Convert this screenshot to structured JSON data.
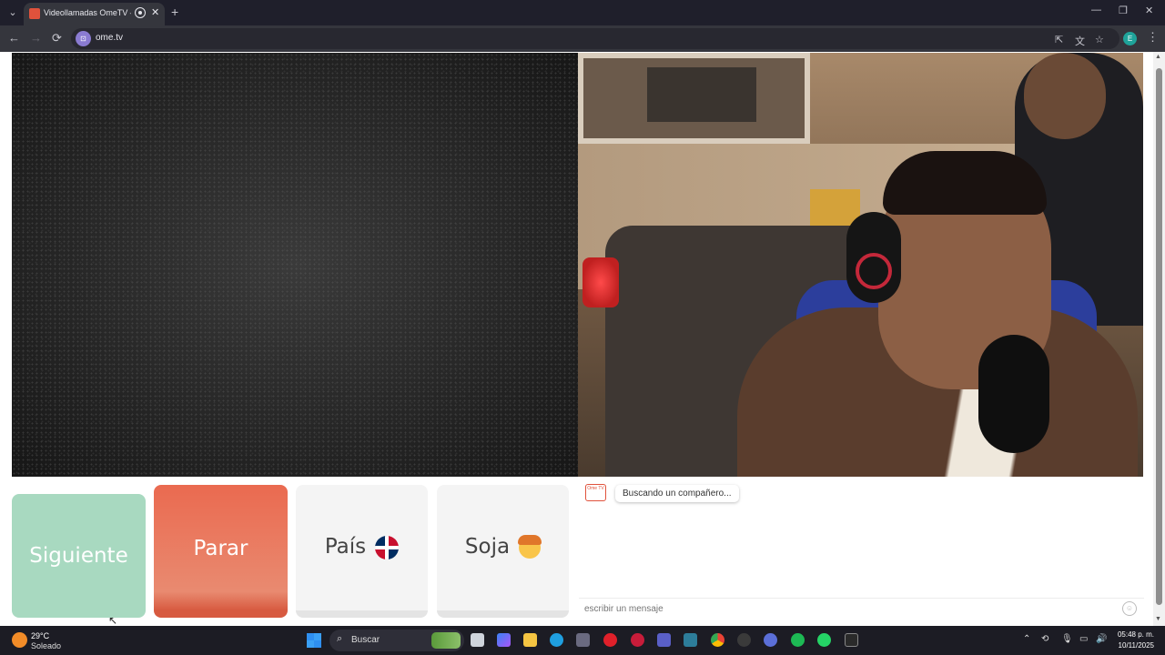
{
  "browser": {
    "tab": {
      "title": "Videollamadas OmeTV — /",
      "close": "✕"
    },
    "new_tab": "+",
    "window_controls": {
      "minimize": "—",
      "restore": "❐",
      "close": "✕"
    },
    "nav": {
      "back": "←",
      "forward": "→",
      "reload": "⟳"
    },
    "url": "ome.tv",
    "site_icon": "⊡",
    "profile_initial": "E",
    "menu": "⋮"
  },
  "page": {
    "buttons": {
      "next": "Siguiente",
      "stop": "Parar",
      "country": "País",
      "gender": "Soja"
    },
    "chat": {
      "logo": "Ome TV",
      "status_message": "Buscando un compañero...",
      "input_placeholder": "escribir un mensaje",
      "emoji": "☺"
    }
  },
  "taskbar": {
    "weather": {
      "temp": "29°C",
      "condition": "Soleado"
    },
    "search_label": "Buscar",
    "clock": {
      "time": "05:48 p. m.",
      "date": "10/11/2025"
    }
  },
  "colors": {
    "next_button": "#a8d9c0",
    "stop_button": "#ea6a50",
    "ome_brand": "#e0523c"
  },
  "icons": {
    "tab_favicon": "ometv-favicon-icon",
    "recording": "record-icon",
    "country_flag": "dominican-flag-icon",
    "gender": "boy-face-icon",
    "weather": "sun-icon"
  }
}
